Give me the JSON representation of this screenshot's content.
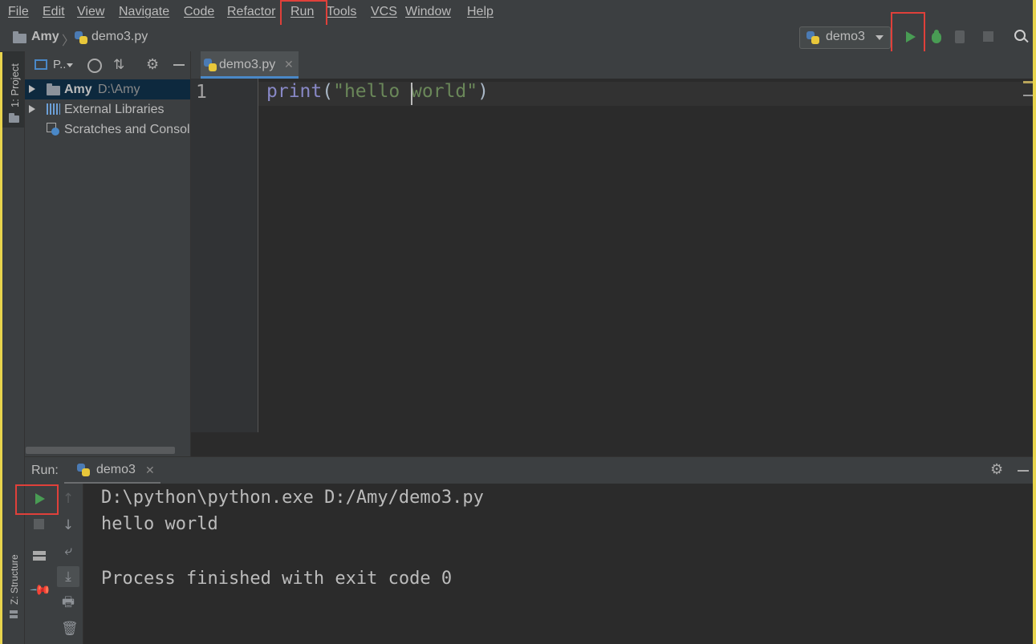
{
  "menu": {
    "items": [
      "File",
      "Edit",
      "View",
      "Navigate",
      "Code",
      "Refactor",
      "Run",
      "Tools",
      "VCS",
      "Window",
      "Help"
    ]
  },
  "breadcrumb": {
    "project": "Amy",
    "file": "demo3.py"
  },
  "run_config": {
    "selected": "demo3"
  },
  "left_stripe": {
    "project_tab": "1: Project",
    "structure_tab": "Z: Structure"
  },
  "project_panel": {
    "view_selector": "P..",
    "tree": [
      {
        "name": "Amy",
        "path": "D:\\Amy"
      },
      {
        "name": "External Libraries"
      },
      {
        "name": "Scratches and Consol"
      }
    ]
  },
  "editor": {
    "tab_label": "demo3.py",
    "line_number": "1",
    "code_func": "print",
    "code_open": "(",
    "code_string": "\"hello world\"",
    "code_close": ")"
  },
  "run_panel": {
    "label": "Run:",
    "tab_label": "demo3",
    "console": [
      "D:\\python\\python.exe D:/Amy/demo3.py",
      "hello world",
      "",
      "Process finished with exit code 0"
    ]
  },
  "colors": {
    "accent_red_box": "#e0403a",
    "run_green": "#499c54",
    "string_green": "#6a8759",
    "keyword_purple": "#8888c6"
  }
}
